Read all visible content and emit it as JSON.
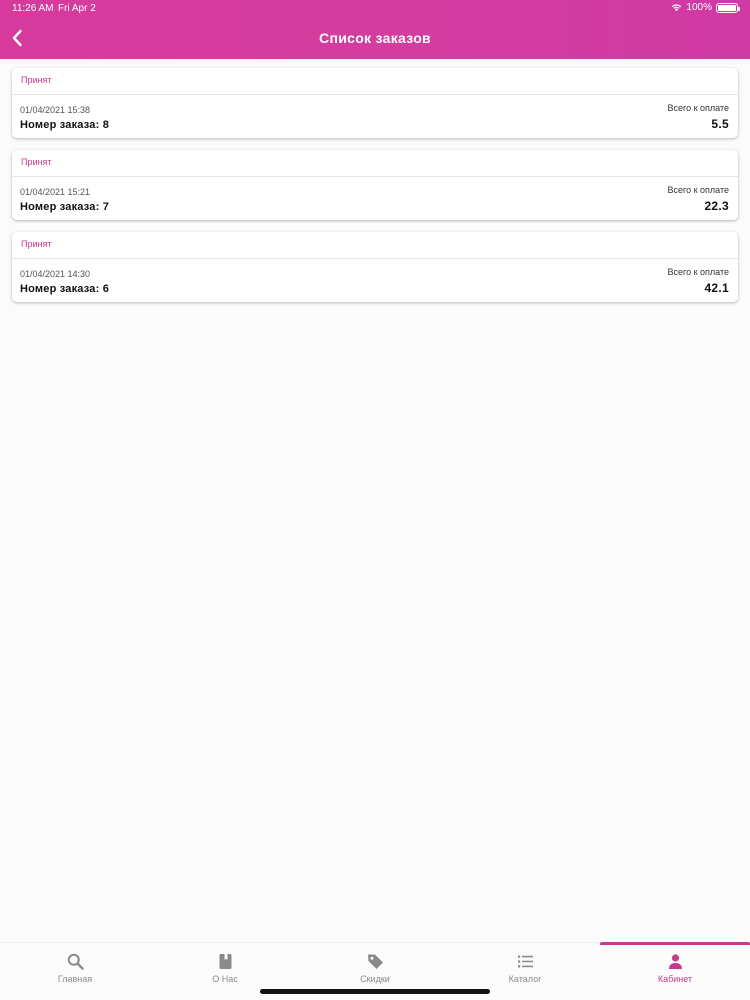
{
  "status_bar": {
    "time": "11:26 AM",
    "date": "Fri Apr 2",
    "battery": "100%"
  },
  "header": {
    "title": "Список заказов",
    "back_icon": "chevron-left-icon"
  },
  "orders": [
    {
      "status": "Принят",
      "date": "01/04/2021 15:38",
      "number": "Номер заказа: 8",
      "total_label": "Всего к оплате",
      "total": "5.5"
    },
    {
      "status": "Принят",
      "date": "01/04/2021 15:21",
      "number": "Номер заказа: 7",
      "total_label": "Всего к оплате",
      "total": "22.3"
    },
    {
      "status": "Принят",
      "date": "01/04/2021 14:30",
      "number": "Номер заказа: 6",
      "total_label": "Всего к оплате",
      "total": "42.1"
    }
  ],
  "tabs": [
    {
      "label": "Главная",
      "icon": "search-icon"
    },
    {
      "label": "О Нас",
      "icon": "book-icon"
    },
    {
      "label": "Скидки",
      "icon": "tag-icon"
    },
    {
      "label": "Каталог",
      "icon": "list-icon"
    },
    {
      "label": "Кабинет",
      "icon": "person-icon",
      "active": true
    }
  ],
  "colors": {
    "accent": "#c83a8e",
    "header": "#d43d9f",
    "inactive_tab": "#8a8a8a"
  }
}
